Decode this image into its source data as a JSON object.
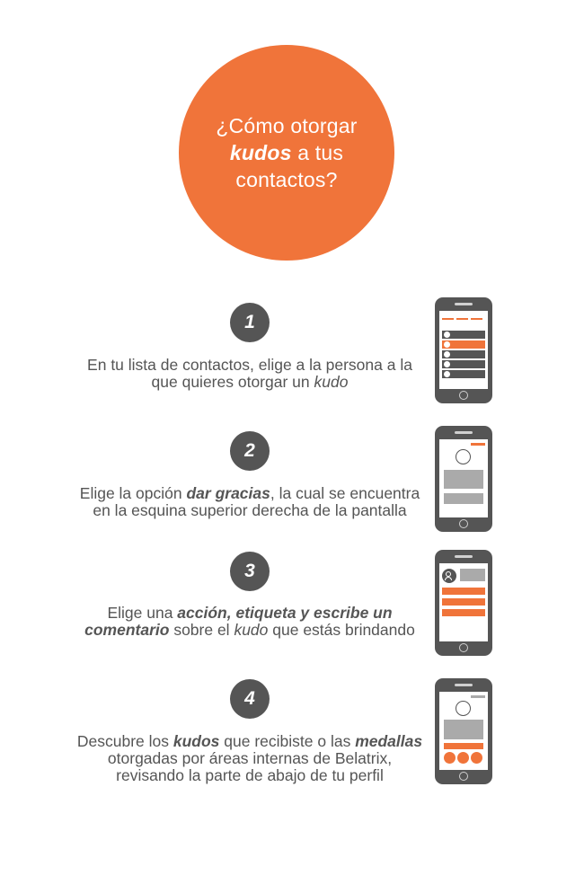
{
  "title": {
    "line1": "¿Cómo otorgar",
    "line2_bold": "kudos",
    "line2_rest": " a tus",
    "line3": "contactos?"
  },
  "colors": {
    "accent": "#f0743a",
    "dark": "#555555",
    "light": "#aaaaaa"
  },
  "steps": [
    {
      "number": "1",
      "t1": "En tu lista de contactos, elige a la persona a la que quieres otorgar un ",
      "t2_italic": "kudo"
    },
    {
      "number": "2",
      "t1": "Elige la opción ",
      "t2_bold": "dar gracias",
      "t3": ", la cual se encuentra en la esquina superior derecha de la pantalla"
    },
    {
      "number": "3",
      "t1": "Elige una ",
      "t2_bold": "acción, etiqueta y escribe un comentario",
      "t3": " sobre el ",
      "t4_italic": "kudo",
      "t5": " que estás brindando"
    },
    {
      "number": "4",
      "t1": "Descubre los ",
      "t2_bold": "kudos",
      "t3": " que recibiste o las ",
      "t4_bold": "medallas",
      "t5": " otorgadas por áreas internas de Belatrix, revisando la parte de abajo de tu perfil"
    }
  ],
  "icons": {
    "step1": "phone-contact-list-icon",
    "step2": "phone-profile-icon",
    "step3": "phone-kudo-form-icon",
    "step4": "phone-profile-medals-icon"
  }
}
